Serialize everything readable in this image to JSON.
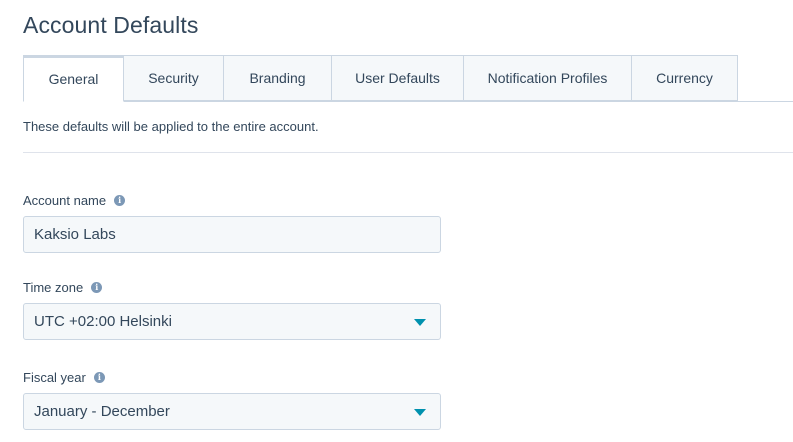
{
  "page": {
    "title": "Account Defaults",
    "intro": "These defaults will be applied to the entire account."
  },
  "tabs": [
    {
      "label": "General",
      "active": true
    },
    {
      "label": "Security",
      "active": false
    },
    {
      "label": "Branding",
      "active": false
    },
    {
      "label": "User Defaults",
      "active": false
    },
    {
      "label": "Notification Profiles",
      "active": false
    },
    {
      "label": "Currency",
      "active": false
    }
  ],
  "fields": {
    "account_name": {
      "label": "Account name",
      "value": "Kaksio Labs"
    },
    "time_zone": {
      "label": "Time zone",
      "value": "UTC +02:00 Helsinki"
    },
    "fiscal_year": {
      "label": "Fiscal year",
      "value": "January - December"
    }
  },
  "icons": {
    "info": "info-circle-icon",
    "dropdown": "caret-down-icon"
  },
  "colors": {
    "text": "#33475b",
    "border": "#cbd6e2",
    "input_bg": "#f5f8fa",
    "accent": "#0091ae",
    "info_icon": "#7c98b6"
  }
}
